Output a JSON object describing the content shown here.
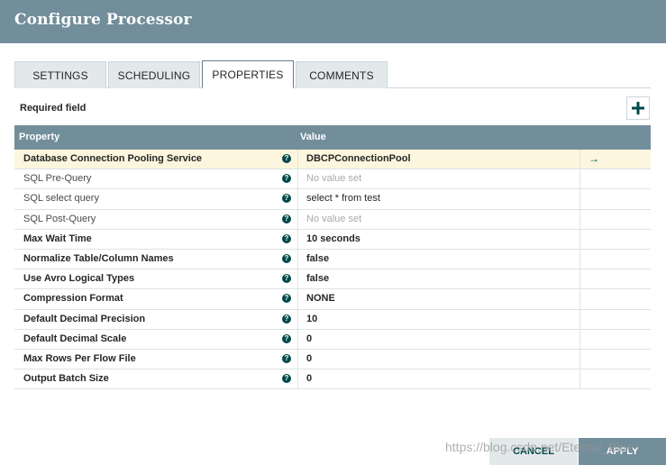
{
  "window": {
    "title": "Configure Processor"
  },
  "tabs": [
    {
      "label": "SETTINGS",
      "active": false
    },
    {
      "label": "SCHEDULING",
      "active": false
    },
    {
      "label": "PROPERTIES",
      "active": true
    },
    {
      "label": "COMMENTS",
      "active": false
    }
  ],
  "properties_panel": {
    "required_label": "Required field",
    "add_icon": "plus-icon",
    "columns": {
      "property": "Property",
      "value": "Value"
    },
    "help_glyph": "?",
    "goto_glyph": "→",
    "rows": [
      {
        "name": "Database Connection Pooling Service",
        "required": true,
        "value": "DBCPConnectionPool",
        "is_set": true,
        "controller_service": true
      },
      {
        "name": "SQL Pre-Query",
        "required": false,
        "value": "No value set",
        "is_set": false
      },
      {
        "name": "SQL select query",
        "required": false,
        "value": "select * from test",
        "is_set": true
      },
      {
        "name": "SQL Post-Query",
        "required": false,
        "value": "No value set",
        "is_set": false
      },
      {
        "name": "Max Wait Time",
        "required": true,
        "value": "10 seconds",
        "is_set": true
      },
      {
        "name": "Normalize Table/Column Names",
        "required": true,
        "value": "false",
        "is_set": true
      },
      {
        "name": "Use Avro Logical Types",
        "required": true,
        "value": "false",
        "is_set": true
      },
      {
        "name": "Compression Format",
        "required": true,
        "value": "NONE",
        "is_set": true
      },
      {
        "name": "Default Decimal Precision",
        "required": true,
        "value": "10",
        "is_set": true
      },
      {
        "name": "Default Decimal Scale",
        "required": true,
        "value": "0",
        "is_set": true
      },
      {
        "name": "Max Rows Per Flow File",
        "required": true,
        "value": "0",
        "is_set": true
      },
      {
        "name": "Output Batch Size",
        "required": true,
        "value": "0",
        "is_set": true
      }
    ]
  },
  "footer": {
    "cancel_label": "CANCEL",
    "apply_label": "APPLY"
  },
  "watermark": "https://blog.csdn.net/Eternal_Blue",
  "colors": {
    "header": "#728e9b",
    "highlight_row": "#fbf6dd",
    "accent": "#004849",
    "tab_inactive": "#e3e8eb"
  }
}
